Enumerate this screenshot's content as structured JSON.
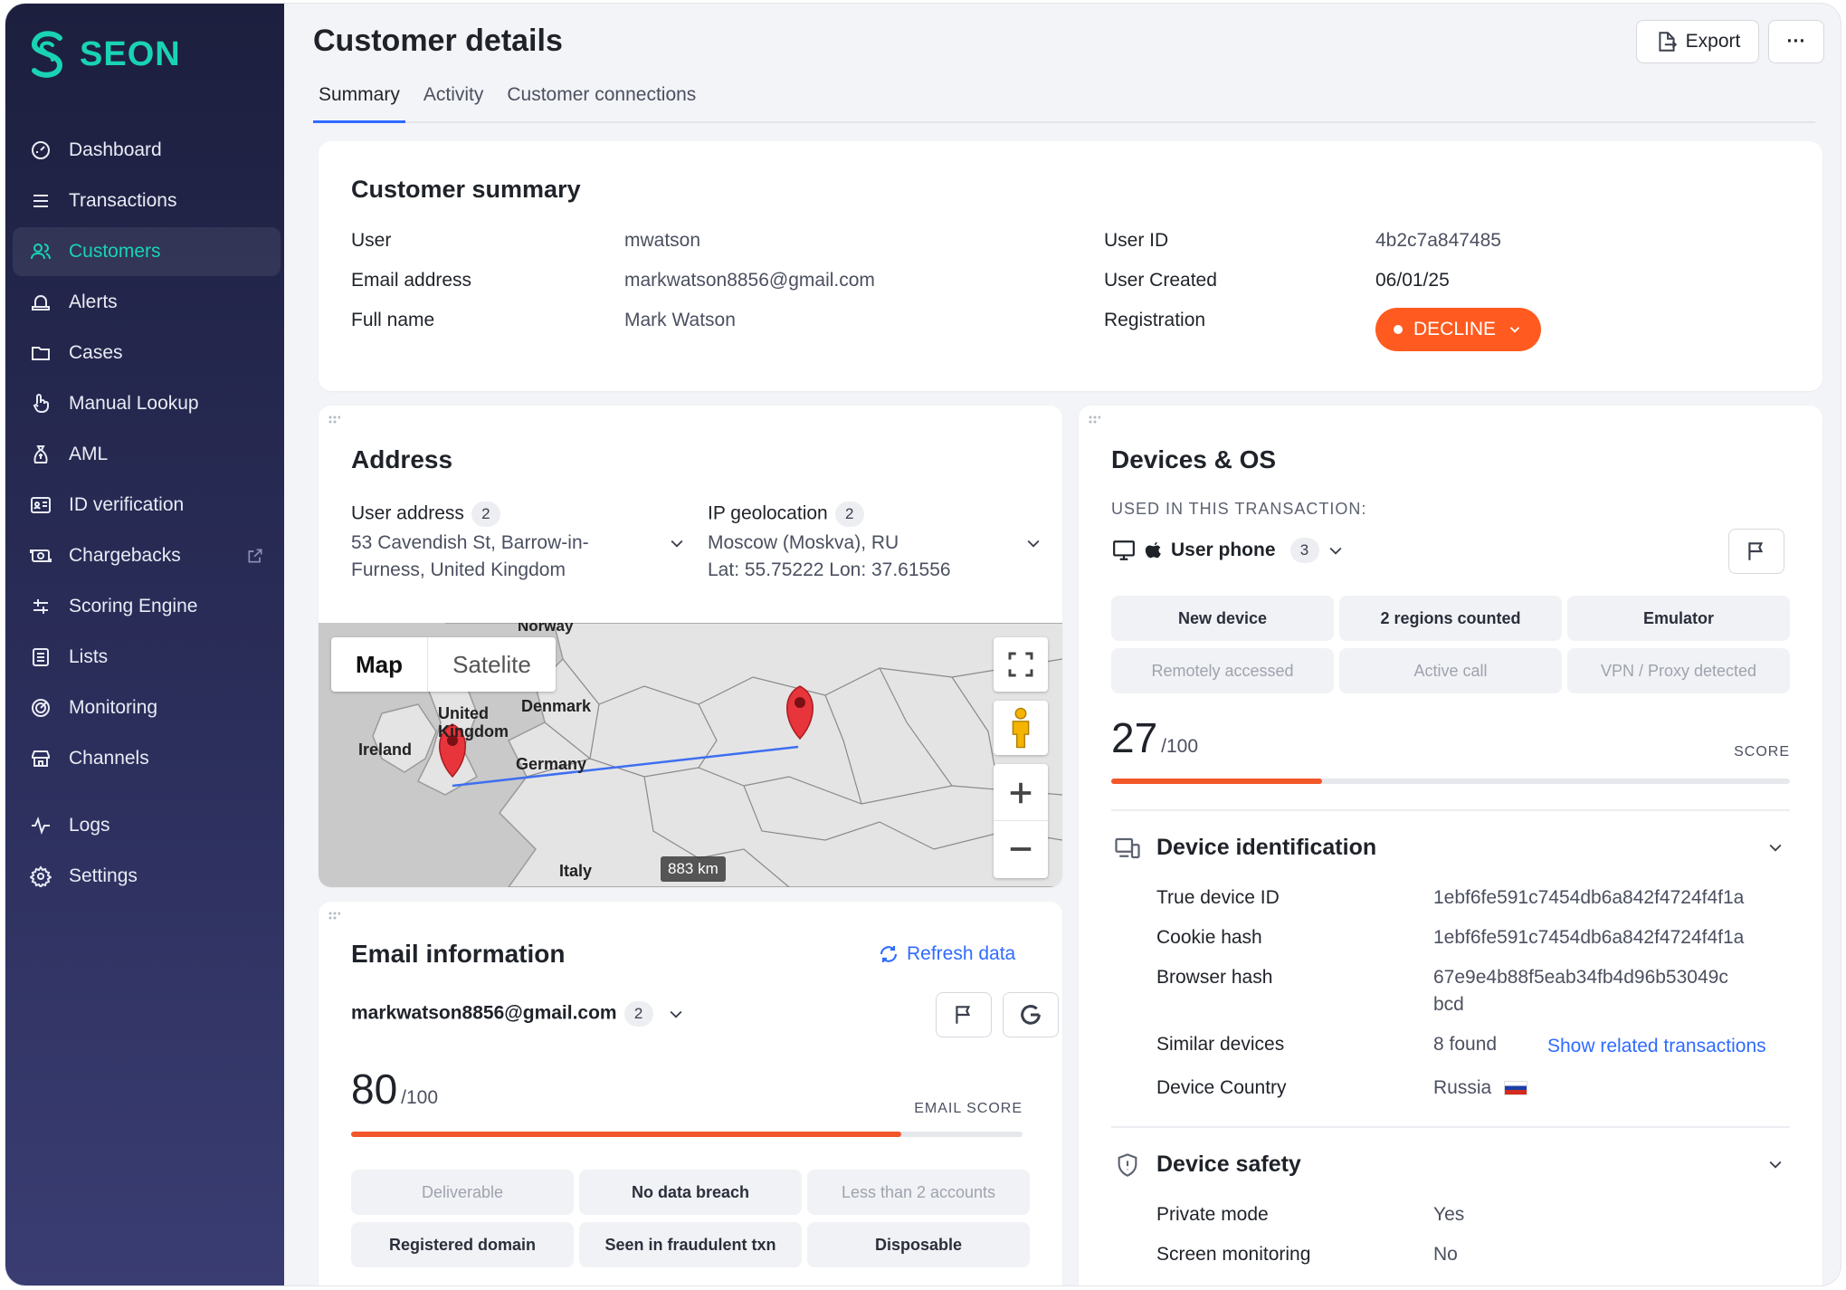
{
  "brand": {
    "name": "SEON",
    "accent": "#19d3b4"
  },
  "sidebar": {
    "items": [
      {
        "label": "Dashboard",
        "icon": "dashboard-icon"
      },
      {
        "label": "Transactions",
        "icon": "list-icon"
      },
      {
        "label": "Customers",
        "icon": "users-icon",
        "active": true
      },
      {
        "label": "Alerts",
        "icon": "alert-icon"
      },
      {
        "label": "Cases",
        "icon": "folder-icon"
      },
      {
        "label": "Manual Lookup",
        "icon": "hand-icon"
      },
      {
        "label": "AML",
        "icon": "aml-icon"
      },
      {
        "label": "ID verification",
        "icon": "id-card-icon"
      },
      {
        "label": "Chargebacks",
        "icon": "chargeback-icon",
        "external": true
      },
      {
        "label": "Scoring Engine",
        "icon": "sliders-icon"
      },
      {
        "label": "Lists",
        "icon": "lists-icon"
      },
      {
        "label": "Monitoring",
        "icon": "monitoring-icon"
      },
      {
        "label": "Channels",
        "icon": "store-icon"
      }
    ],
    "bottom_items": [
      {
        "label": "Logs",
        "icon": "pulse-icon"
      },
      {
        "label": "Settings",
        "icon": "gear-icon"
      }
    ]
  },
  "header": {
    "title": "Customer details",
    "tabs": [
      "Summary",
      "Activity",
      "Customer connections"
    ],
    "export_label": "Export",
    "more_label": "···"
  },
  "summary": {
    "title": "Customer summary",
    "left": [
      {
        "label": "User",
        "value": "mwatson"
      },
      {
        "label": "Email address",
        "value": "markwatson8856@gmail.com"
      },
      {
        "label": "Full name",
        "value": "Mark Watson"
      }
    ],
    "right": [
      {
        "label": "User ID",
        "value": "4b2c7a847485"
      },
      {
        "label": "User Created",
        "value": "06/01/25"
      },
      {
        "label": "Registration",
        "value": "DECLINE"
      }
    ],
    "decline_color": "#ff5a1f"
  },
  "address": {
    "title": "Address",
    "user_address_label": "User address",
    "user_address_count": "2",
    "user_address_line1": "53 Cavendish St, Barrow-in-",
    "user_address_line2": "Furness, United Kingdom",
    "ip_label": "IP geolocation",
    "ip_count": "2",
    "ip_line1": "Moscow (Moskva), RU",
    "ip_line2": "Lat: 55.75222 Lon: 37.61556",
    "map": {
      "tab_map": "Map",
      "tab_satellite": "Satelite",
      "labels": [
        "Norway",
        "Denmark",
        "United",
        "Kingdom",
        "Ireland",
        "Germany",
        "Italy"
      ],
      "distance": "883 km"
    }
  },
  "email": {
    "title": "Email information",
    "refresh_label": "Refresh data",
    "address": "markwatson8856@gmail.com",
    "count": "2",
    "score": "80",
    "score_max": "/100",
    "score_label": "EMAIL SCORE",
    "score_fraction": 0.82,
    "chips": [
      {
        "label": "Deliverable",
        "on": false
      },
      {
        "label": "No data breach",
        "on": true
      },
      {
        "label": "Less than 2 accounts",
        "on": false
      },
      {
        "label": "Registered domain",
        "on": true
      },
      {
        "label": "Seen in fraudulent txn",
        "on": true
      },
      {
        "label": "Disposable",
        "on": true
      }
    ]
  },
  "devices": {
    "title": "Devices & OS",
    "used_label": "USED IN THIS TRANSACTION:",
    "device_name": "User phone",
    "device_count": "3",
    "chips": [
      {
        "label": "New device",
        "on": true
      },
      {
        "label": "2 regions counted",
        "on": true
      },
      {
        "label": "Emulator",
        "on": true
      },
      {
        "label": "Remotely accessed",
        "on": false
      },
      {
        "label": "Active call",
        "on": false
      },
      {
        "label": "VPN / Proxy detected",
        "on": false
      }
    ],
    "score": "27",
    "score_max": "/100",
    "score_label": "SCORE",
    "score_fraction": 0.31,
    "identification": {
      "title": "Device identification",
      "rows": [
        {
          "label": "True device ID",
          "value": "1ebf6fe591c7454db6a842f4724f4f1a"
        },
        {
          "label": "Cookie hash",
          "value": "1ebf6fe591c7454db6a842f4724f4f1a"
        },
        {
          "label": "Browser hash",
          "value": "67e9e4b88f5eab34fb4d96b53049c",
          "value2": "bcd"
        },
        {
          "label": "Similar devices",
          "value": "8 found",
          "link": "Show related transactions"
        },
        {
          "label": "Device Country",
          "value": "Russia"
        }
      ]
    },
    "safety": {
      "title": "Device safety",
      "rows": [
        {
          "label": "Private mode",
          "value": "Yes"
        },
        {
          "label": "Screen monitoring",
          "value": "No"
        }
      ]
    }
  }
}
